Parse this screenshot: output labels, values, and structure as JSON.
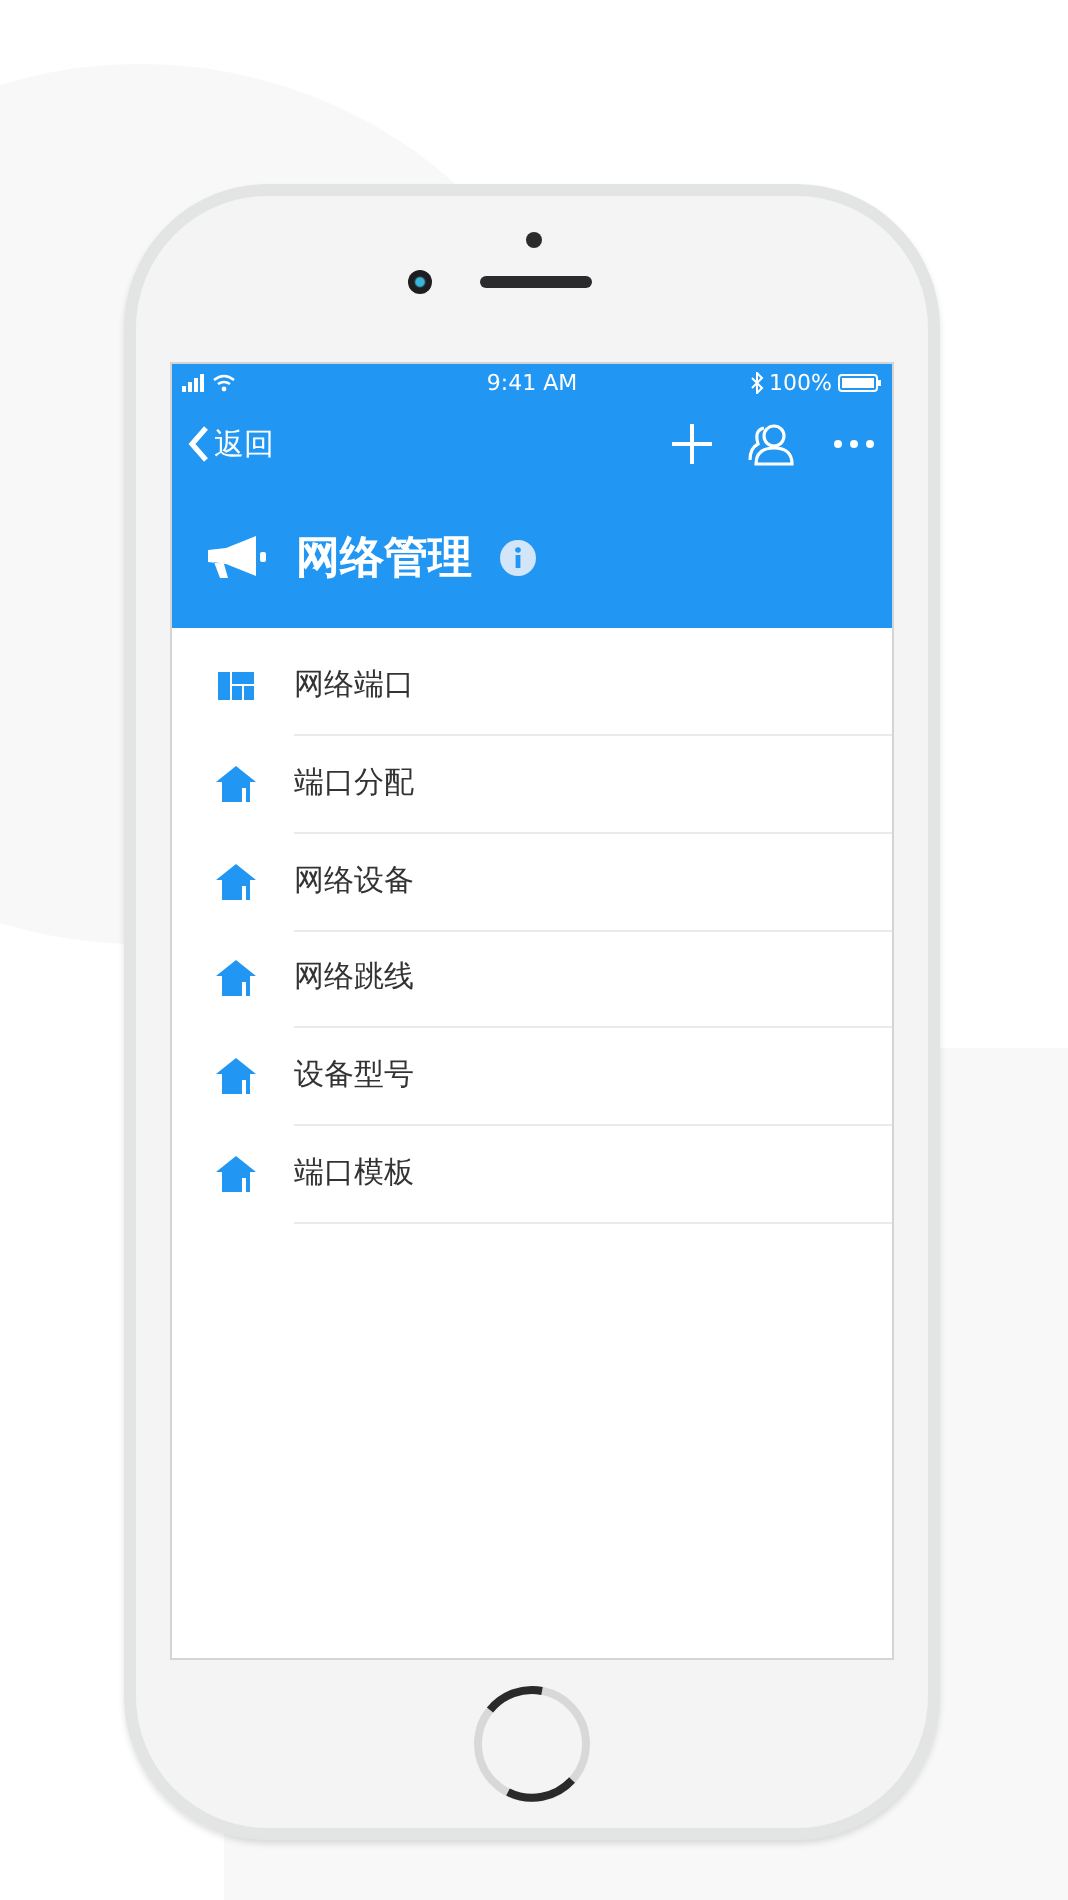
{
  "status_bar": {
    "time": "9:41 AM",
    "battery": "100%"
  },
  "nav_bar": {
    "back": "返回"
  },
  "header": {
    "title": "网络管理"
  },
  "items": [
    {
      "label": "网络端口",
      "kind": "grid"
    },
    {
      "label": "端口分配",
      "kind": "home"
    },
    {
      "label": "网络设备",
      "kind": "home"
    },
    {
      "label": "网络跳线",
      "kind": "home"
    },
    {
      "label": "设备型号",
      "kind": "home"
    },
    {
      "label": "端口模板",
      "kind": "home"
    }
  ]
}
